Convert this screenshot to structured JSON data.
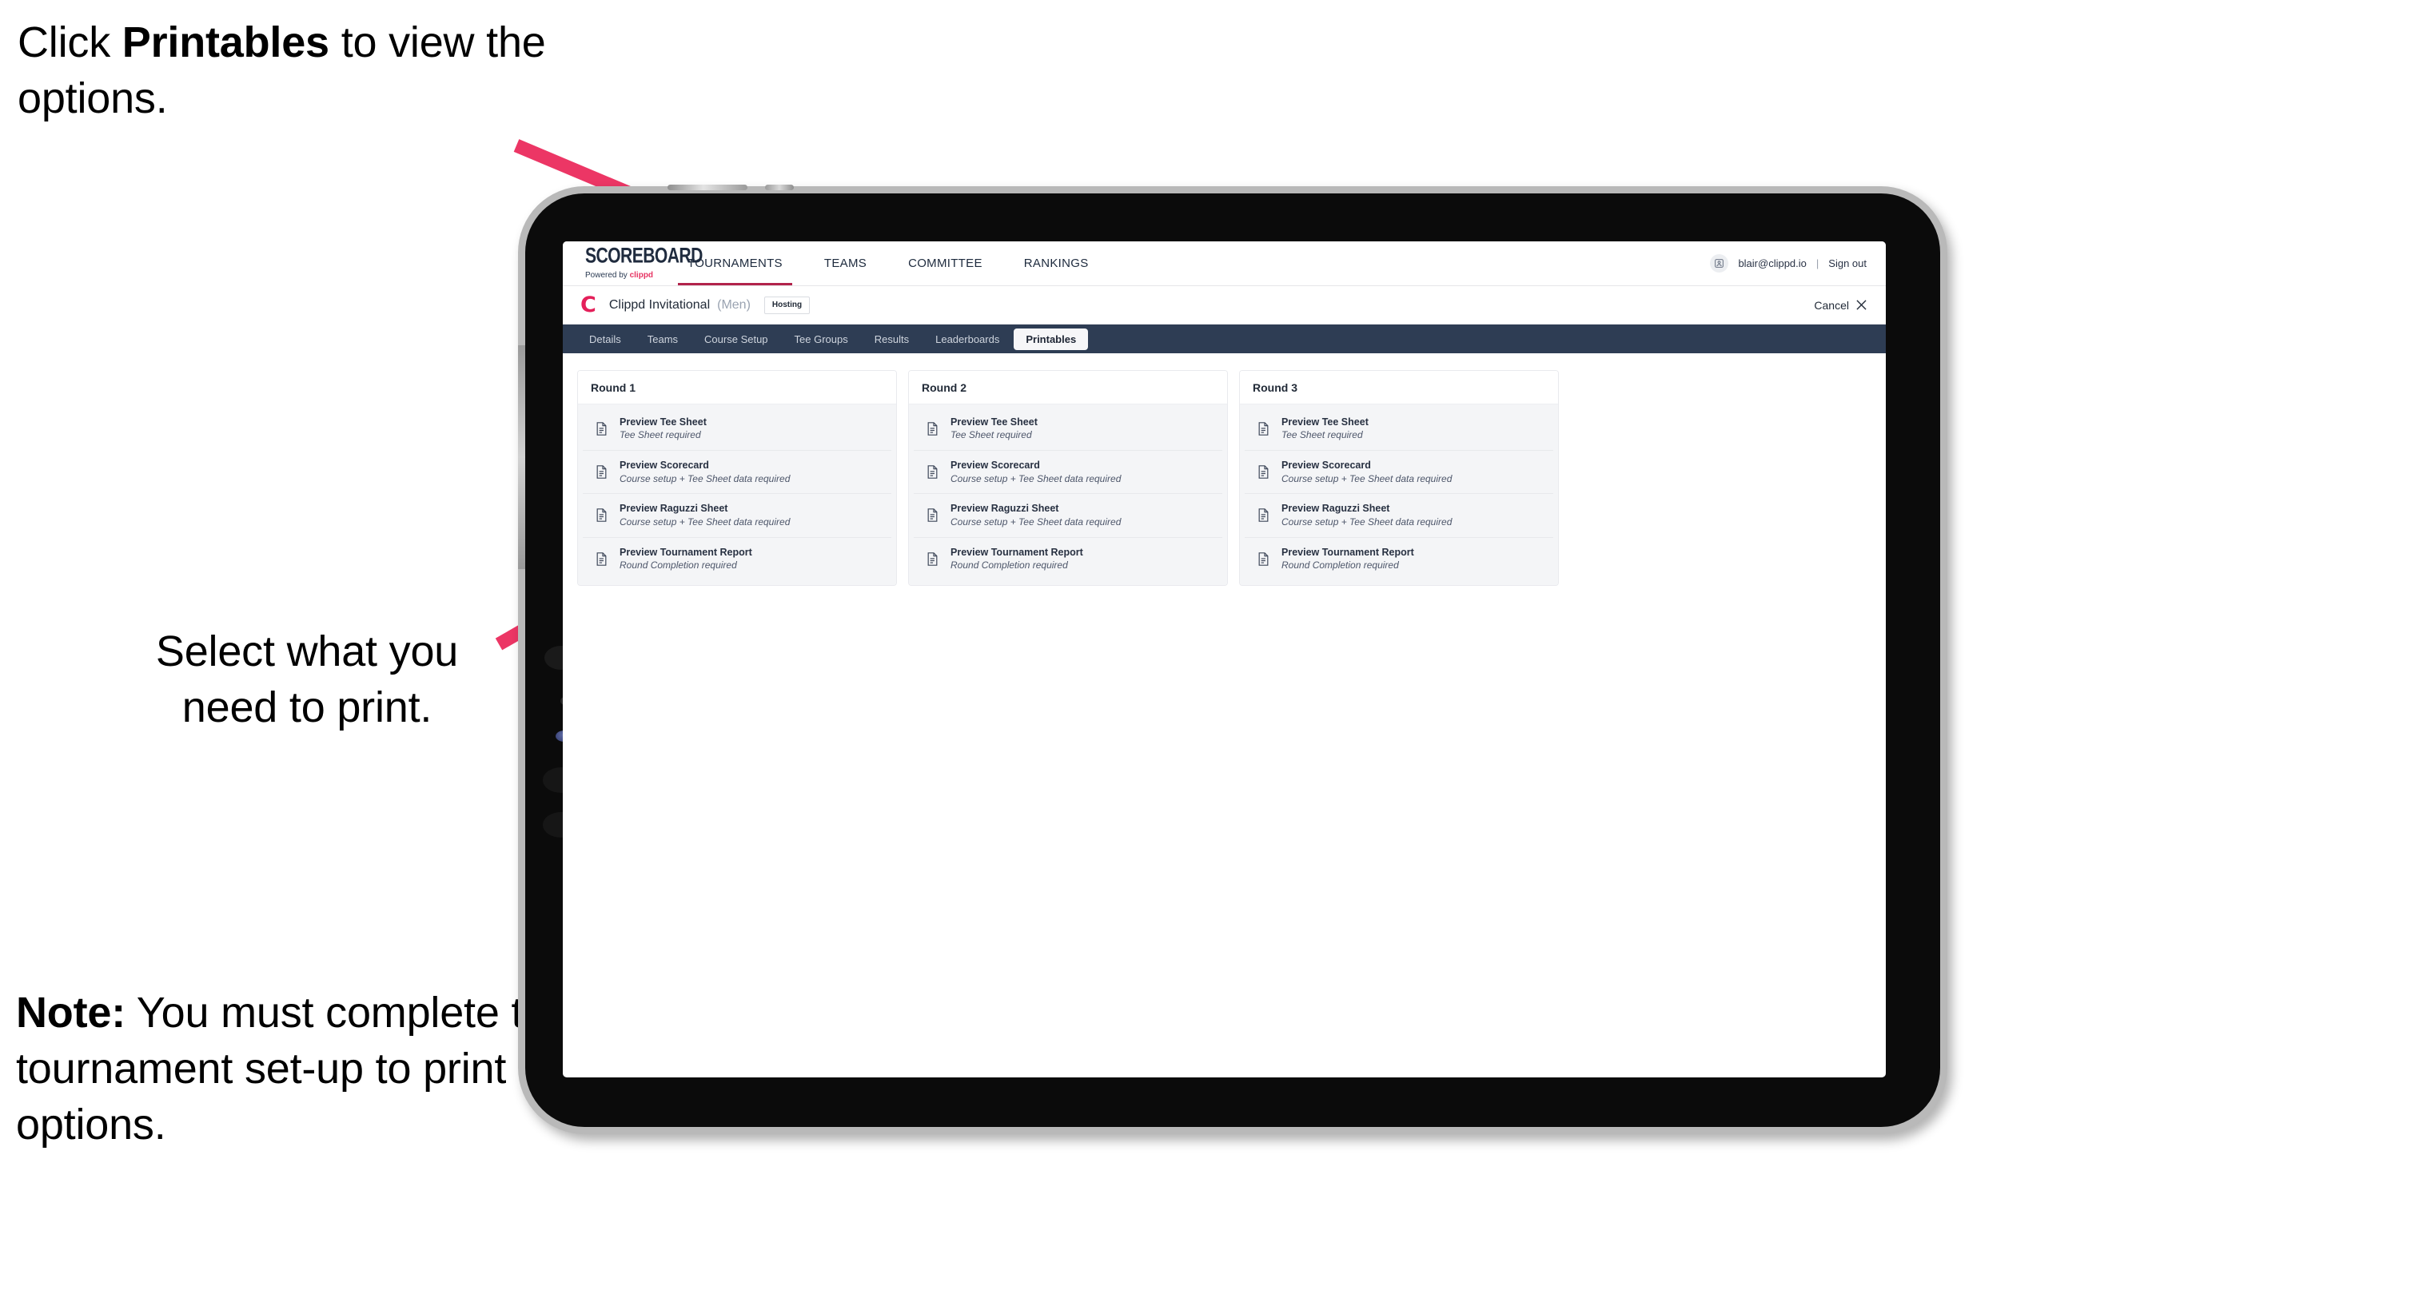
{
  "annotations": {
    "top": {
      "pre": "Click ",
      "bold": "Printables",
      "post": " to view the options."
    },
    "middle": {
      "line1": "Select what you",
      "line2": "need to print."
    },
    "note": {
      "bold": "Note:",
      "text": " You must complete the tournament set-up to print all the options."
    }
  },
  "colors": {
    "arrow_pink": "#ec3665",
    "navy_bar": "#2e3d54",
    "brand_pink": "#e4205a",
    "accent_underline": "#b2234b"
  },
  "app": {
    "brand": {
      "wordmark": "SCOREBOARD",
      "powered_prefix": "Powered by ",
      "powered_brand": "clippd"
    },
    "topnav": [
      {
        "label": "TOURNAMENTS",
        "active": true
      },
      {
        "label": "TEAMS",
        "active": false
      },
      {
        "label": "COMMITTEE",
        "active": false
      },
      {
        "label": "RANKINGS",
        "active": false
      }
    ],
    "account": {
      "avatar_icon": "user-avatar-icon",
      "email": "blair@clippd.io",
      "separator": "|",
      "sign_out": "Sign out"
    },
    "tournament_bar": {
      "logo_letter": "C",
      "name": "Clippd Invitational",
      "gender": "(Men)",
      "status_badge": "Hosting",
      "cancel_label": "Cancel",
      "cancel_icon": "close-icon"
    },
    "tabs": [
      {
        "label": "Details",
        "active": false
      },
      {
        "label": "Teams",
        "active": false
      },
      {
        "label": "Course Setup",
        "active": false
      },
      {
        "label": "Tee Groups",
        "active": false
      },
      {
        "label": "Results",
        "active": false
      },
      {
        "label": "Leaderboards",
        "active": false
      },
      {
        "label": "Printables",
        "active": true
      }
    ],
    "rounds": [
      {
        "title": "Round 1",
        "items": [
          {
            "icon": "document-icon",
            "title": "Preview Tee Sheet",
            "subtitle": "Tee Sheet required"
          },
          {
            "icon": "document-icon",
            "title": "Preview Scorecard",
            "subtitle": "Course setup + Tee Sheet data required"
          },
          {
            "icon": "document-icon",
            "title": "Preview Raguzzi Sheet",
            "subtitle": "Course setup + Tee Sheet data required"
          },
          {
            "icon": "document-icon",
            "title": "Preview Tournament Report",
            "subtitle": "Round Completion required"
          }
        ]
      },
      {
        "title": "Round 2",
        "items": [
          {
            "icon": "document-icon",
            "title": "Preview Tee Sheet",
            "subtitle": "Tee Sheet required"
          },
          {
            "icon": "document-icon",
            "title": "Preview Scorecard",
            "subtitle": "Course setup + Tee Sheet data required"
          },
          {
            "icon": "document-icon",
            "title": "Preview Raguzzi Sheet",
            "subtitle": "Course setup + Tee Sheet data required"
          },
          {
            "icon": "document-icon",
            "title": "Preview Tournament Report",
            "subtitle": "Round Completion required"
          }
        ]
      },
      {
        "title": "Round 3",
        "items": [
          {
            "icon": "document-icon",
            "title": "Preview Tee Sheet",
            "subtitle": "Tee Sheet required"
          },
          {
            "icon": "document-icon",
            "title": "Preview Scorecard",
            "subtitle": "Course setup + Tee Sheet data required"
          },
          {
            "icon": "document-icon",
            "title": "Preview Raguzzi Sheet",
            "subtitle": "Course setup + Tee Sheet data required"
          },
          {
            "icon": "document-icon",
            "title": "Preview Tournament Report",
            "subtitle": "Round Completion required"
          }
        ]
      }
    ]
  }
}
